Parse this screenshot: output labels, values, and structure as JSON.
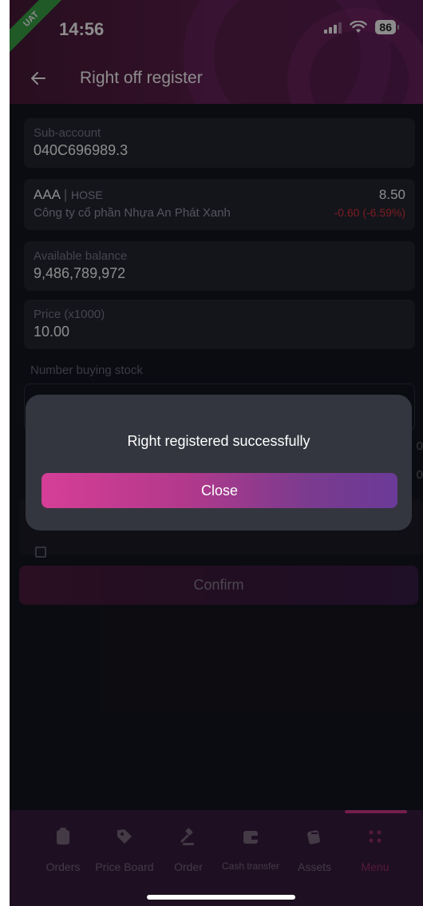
{
  "status_bar": {
    "time": "14:56",
    "battery": "86",
    "env_badge": "UAT"
  },
  "header": {
    "title": "Right off register"
  },
  "sub_account": {
    "label": "Sub-account",
    "value": "040C696989.3"
  },
  "stock": {
    "ticker": "AAA",
    "separator": "|",
    "exchange": "HOSE",
    "company": "Công ty cổ phần Nhựa An Phát Xanh",
    "price": "8.50",
    "change": "-0.60 (-6.59%)"
  },
  "available_balance": {
    "label": "Available balance",
    "value": "9,486,789,972"
  },
  "price": {
    "label": "Price (x1000)",
    "value": "10.00"
  },
  "number_buying": {
    "label": "Number buying stock"
  },
  "partial_values": [
    "0",
    "0"
  ],
  "confirm": {
    "label": "Confirm"
  },
  "modal": {
    "message": "Right registered successfully",
    "close_label": "Close"
  },
  "bottom_nav": {
    "items": [
      {
        "label": "Orders",
        "icon": "clipboard-icon"
      },
      {
        "label": "Price Board",
        "icon": "tag-icon"
      },
      {
        "label": "Order",
        "icon": "gavel-icon"
      },
      {
        "label": "Cash transfer",
        "icon": "wallet-icon"
      },
      {
        "label": "Assets",
        "icon": "cards-icon"
      },
      {
        "label": "Menu",
        "icon": "grid-dots-icon",
        "active": true
      }
    ]
  },
  "colors": {
    "background": "#15161f",
    "card": "#262732",
    "accent_pink": "#d53e96",
    "accent_purple": "#6b3a98",
    "negative": "#e0343c",
    "uat_green": "#3aa548"
  }
}
